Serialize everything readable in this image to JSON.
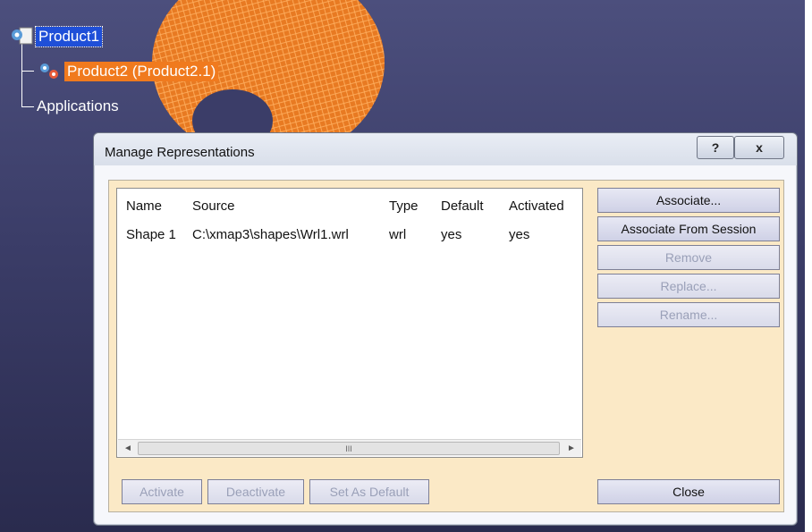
{
  "tree": {
    "root": "Product1",
    "child": "Product2 (Product2.1)",
    "applications": "Applications"
  },
  "dialog": {
    "title": "Manage Representations",
    "help_label": "?",
    "close_glyph": "x",
    "list": {
      "columns": [
        "Name",
        "Source",
        "Type",
        "Default",
        "Activated"
      ],
      "rows": [
        [
          "Shape 1",
          "C:\\xmap3\\shapes\\Wrl1.wrl",
          "wrl",
          "yes",
          "yes"
        ]
      ]
    },
    "scrollbar": {
      "left_arrow": "◄",
      "right_arrow": "►",
      "thumb_grip": "III"
    },
    "buttons": {
      "associate": "Associate...",
      "associate_from_session": "Associate From Session",
      "remove": "Remove",
      "replace": "Replace...",
      "rename": "Rename...",
      "activate": "Activate",
      "deactivate": "Deactivate",
      "set_as_default": "Set As Default",
      "close": "Close"
    }
  },
  "colors": {
    "selection": "#1f4fd8",
    "active_node": "#f07a1e",
    "dialog_client": "#fbe9c6",
    "mesh": "#f08a2a"
  }
}
